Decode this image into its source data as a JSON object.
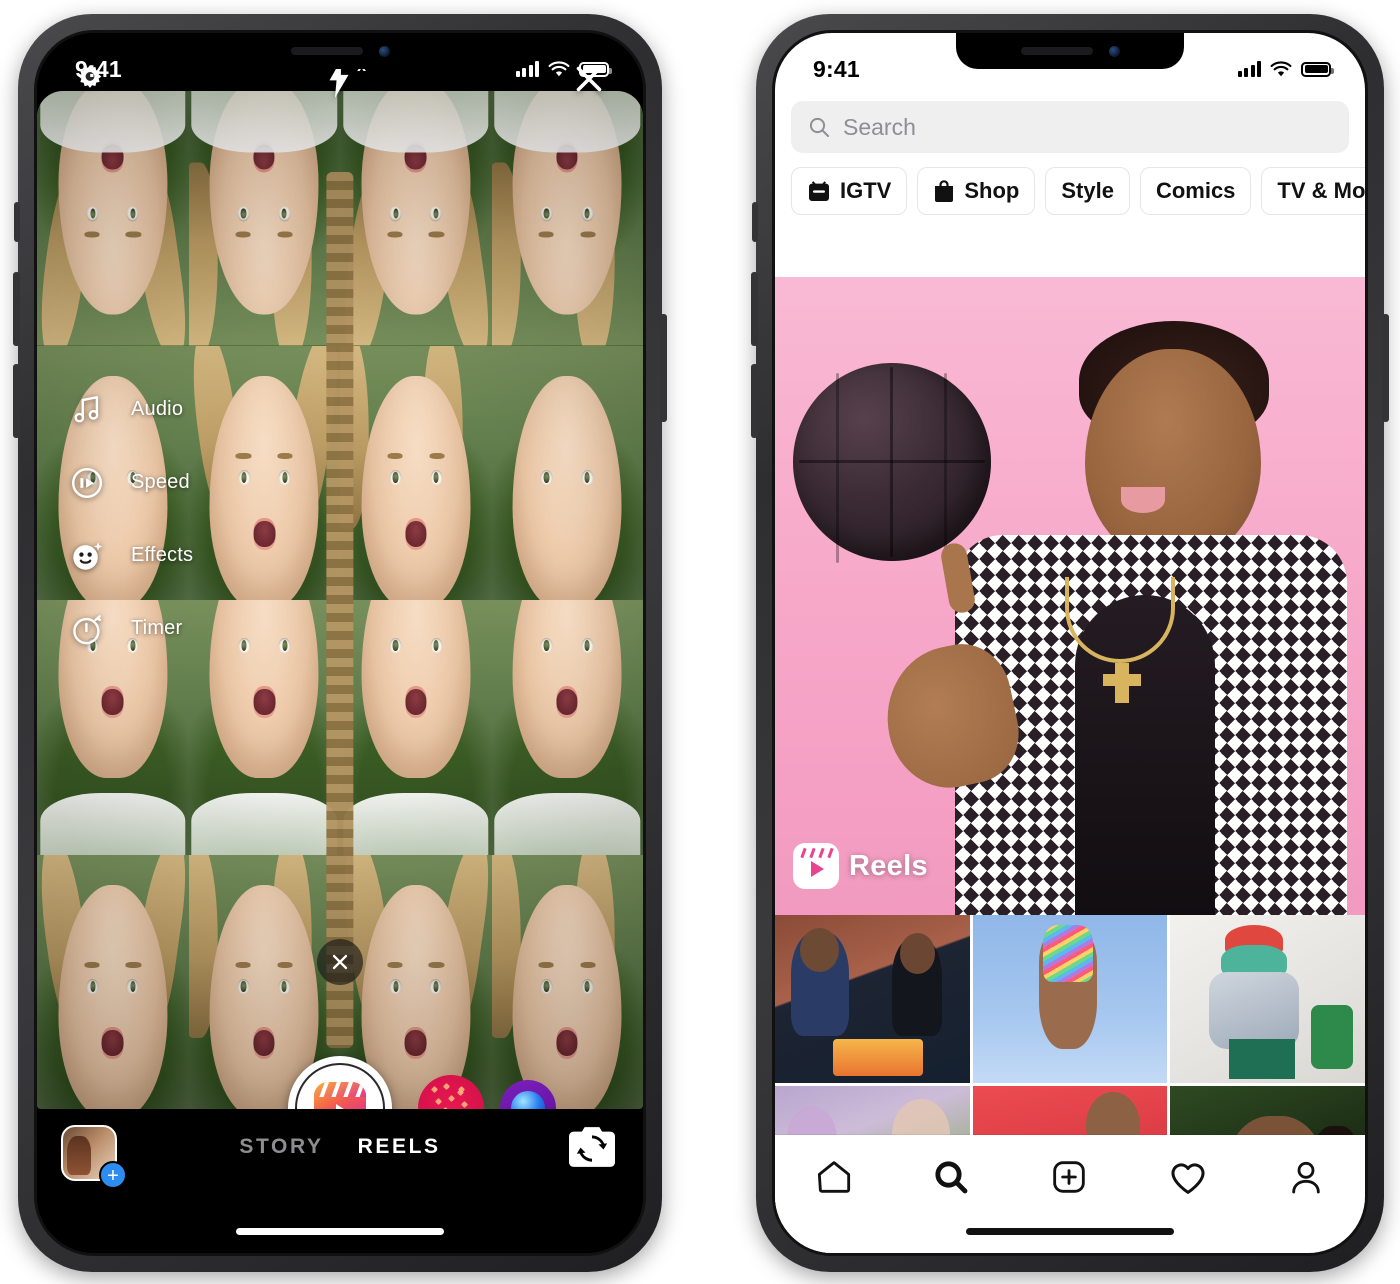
{
  "left_phone": {
    "name": "instagram-reels-camera",
    "status_bar": {
      "time": "9:41",
      "signal": "signal-bars-icon",
      "wifi": "wifi-icon",
      "battery": "battery-full-icon"
    },
    "top_controls": [
      {
        "name": "settings-gear",
        "icon": "gear-icon",
        "label": ""
      },
      {
        "name": "flash-off",
        "icon": "flash-off-icon",
        "label": "x"
      },
      {
        "name": "close-camera",
        "icon": "close-icon",
        "label": ""
      }
    ],
    "tools": [
      {
        "icon": "music-note-icon",
        "label": "Audio"
      },
      {
        "icon": "speed-play-icon",
        "label": "Speed"
      },
      {
        "icon": "smiley-sparkle-icon",
        "label": "Effects"
      },
      {
        "icon": "stopwatch-icon",
        "label": "Timer"
      }
    ],
    "effect_close": {
      "icon": "close-icon",
      "label": ""
    },
    "shutter": {
      "name": "capture-button",
      "icon": "reels-clapperboard-icon"
    },
    "filters": [
      {
        "name": "filter-hearts",
        "icon": "hearts-confetti-icon"
      },
      {
        "name": "filter-gem",
        "icon": "blue-gem-icon"
      }
    ],
    "gallery": {
      "name": "gallery-thumbnail",
      "badge": "+"
    },
    "modes": [
      {
        "label": "STORY",
        "active": false
      },
      {
        "label": "REELS",
        "active": true
      }
    ],
    "flip_camera": {
      "icon": "camera-flip-icon"
    }
  },
  "right_phone": {
    "name": "instagram-explore",
    "status_bar": {
      "time": "9:41",
      "signal": "signal-bars-icon",
      "wifi": "wifi-icon",
      "battery": "battery-full-icon"
    },
    "search": {
      "placeholder": "Search",
      "value": "",
      "icon": "search-icon"
    },
    "chips": [
      {
        "label": "IGTV",
        "icon": "igtv-icon"
      },
      {
        "label": "Shop",
        "icon": "shopping-bag-icon"
      },
      {
        "label": "Style",
        "icon": ""
      },
      {
        "label": "Comics",
        "icon": ""
      },
      {
        "label": "TV & Movie",
        "icon": ""
      }
    ],
    "feature_post": {
      "badge_label": "Reels",
      "badge_icon": "reels-clapperboard-icon"
    },
    "tabbar": [
      {
        "name": "tab-home",
        "icon": "home-icon",
        "active": false
      },
      {
        "name": "tab-search",
        "icon": "search-icon",
        "active": true
      },
      {
        "name": "tab-create",
        "icon": "plus-square-icon",
        "active": false
      },
      {
        "name": "tab-activity",
        "icon": "heart-icon",
        "active": false
      },
      {
        "name": "tab-profile",
        "icon": "person-icon",
        "active": false
      }
    ]
  },
  "colors": {
    "reels_gradient_start": "#f9b233",
    "reels_gradient_end": "#c82ba0",
    "badge_blue": "#2d8cf0",
    "feature_pink": "#f7a8c9",
    "chip_border": "#e6e6e8",
    "search_bg": "#efeff0",
    "inactive_gray": "#8e8e90"
  }
}
